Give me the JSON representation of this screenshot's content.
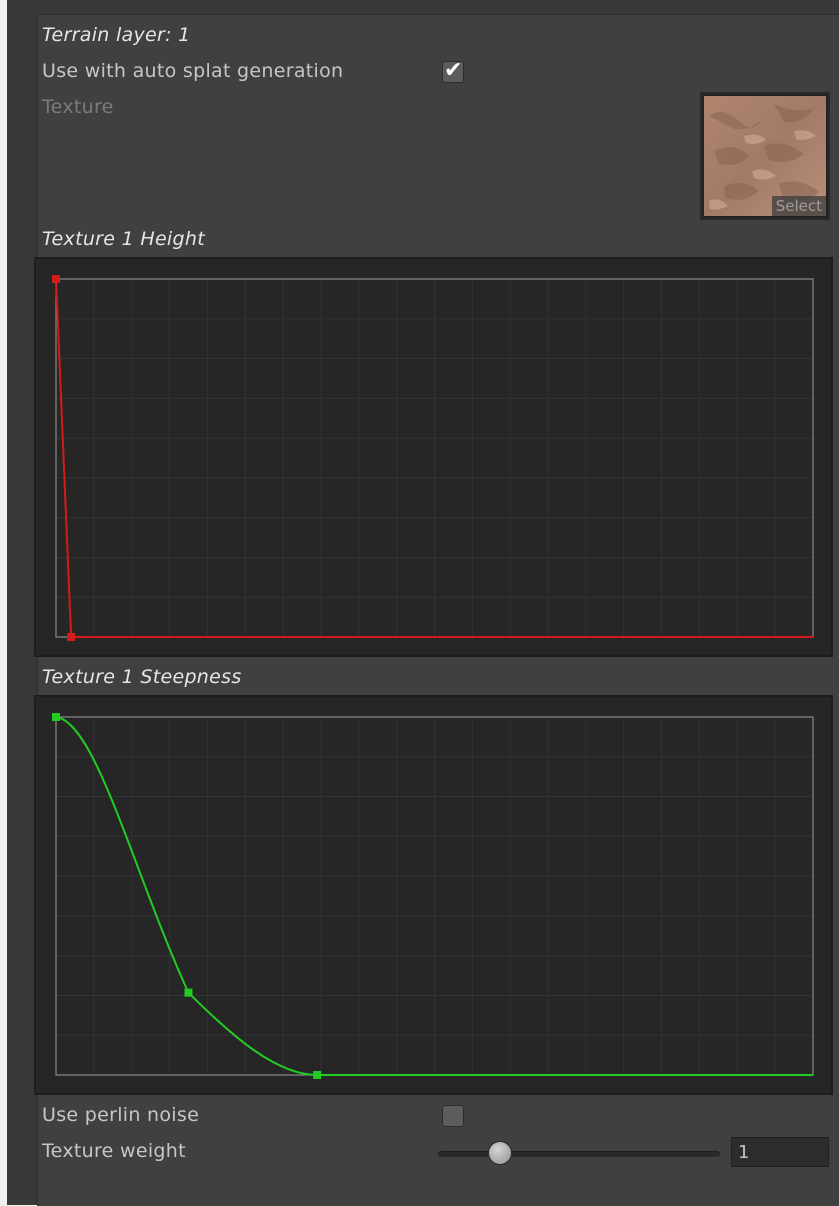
{
  "layer": {
    "title": "Terrain layer: 1",
    "auto_splat_label": "Use with auto splat generation",
    "auto_splat_checked": true,
    "texture_label": "Texture",
    "texture_select_label": "Select"
  },
  "height_curve": {
    "title": "Texture 1 Height",
    "color": "#d41a1a",
    "keys": [
      [
        0.0,
        1.0
      ],
      [
        0.02,
        0.0
      ],
      [
        1.0,
        0.0
      ]
    ]
  },
  "steepness_curve": {
    "title": "Texture 1 Steepness",
    "color": "#22cc22",
    "keys": [
      [
        0.0,
        1.0
      ],
      [
        0.175,
        0.23
      ],
      [
        0.345,
        0.0
      ],
      [
        1.0,
        0.0
      ]
    ]
  },
  "perlin": {
    "label": "Use perlin noise",
    "checked": false
  },
  "weight": {
    "label": "Texture weight",
    "value": "1",
    "slider_fraction": 0.22
  },
  "icons": {
    "checkbox_tick": "✔"
  },
  "colors": {
    "panel": "#404040",
    "curve_bg": "#262626",
    "grid": "#333333"
  }
}
